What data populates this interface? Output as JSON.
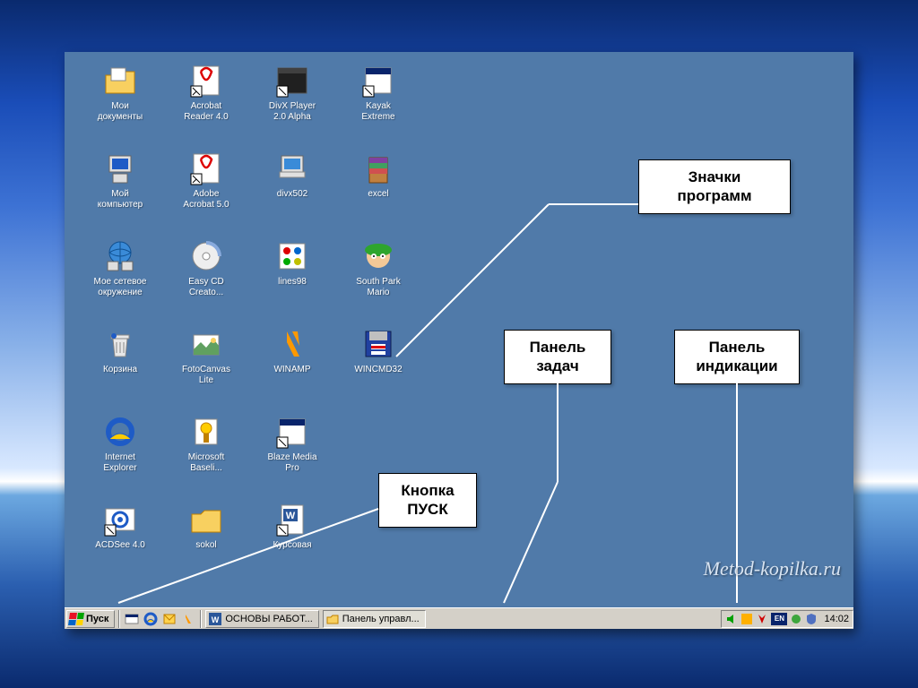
{
  "desktop_icons": [
    {
      "label": "Мои\nдокументы",
      "icon": "folder-docs"
    },
    {
      "label": "Acrobat\nReader 4.0",
      "icon": "acrobat"
    },
    {
      "label": "DivX Player\n2.0 Alpha",
      "icon": "divx"
    },
    {
      "label": "Kayak\nExtreme",
      "icon": "shortcut"
    },
    {
      "label": "Мой\nкомпьютер",
      "icon": "mycomputer"
    },
    {
      "label": "Adobe\nAcrobat 5.0",
      "icon": "acrobat"
    },
    {
      "label": "divx502",
      "icon": "setup"
    },
    {
      "label": "excel",
      "icon": "winrar"
    },
    {
      "label": "Мое сетевое\nокружение",
      "icon": "network"
    },
    {
      "label": "Easy CD\nCreato...",
      "icon": "cd"
    },
    {
      "label": "lines98",
      "icon": "lines"
    },
    {
      "label": "South Park\nMario",
      "icon": "southpark"
    },
    {
      "label": "Корзина",
      "icon": "recycle"
    },
    {
      "label": "FotoCanvas\nLite",
      "icon": "foto"
    },
    {
      "label": "WINAMP",
      "icon": "winamp"
    },
    {
      "label": "WINCMD32",
      "icon": "floppy"
    },
    {
      "label": "Internet\nExplorer",
      "icon": "ie"
    },
    {
      "label": "Microsoft\nBaseli...",
      "icon": "baseline"
    },
    {
      "label": "Blaze Media\nPro",
      "icon": "shortcut"
    },
    {
      "label": "",
      "icon": "none"
    },
    {
      "label": "ACDSee 4.0",
      "icon": "acdsee"
    },
    {
      "label": "sokol",
      "icon": "folder"
    },
    {
      "label": "Курсовая",
      "icon": "word"
    }
  ],
  "callouts": {
    "programs": "Значки\nпрограмм",
    "taskbar": "Панель\nзадач",
    "tray": "Панель\nиндикации",
    "start": "Кнопка\nПУСК"
  },
  "taskbar": {
    "start_label": "Пуск",
    "tasks": [
      {
        "label": "ОСНОВЫ РАБОТ...",
        "icon": "word",
        "active": false
      },
      {
        "label": "Панель управл...",
        "icon": "folder",
        "active": true
      }
    ],
    "clock": "14:02",
    "lang": "EN"
  },
  "watermark": "Metod-kopilka.ru"
}
